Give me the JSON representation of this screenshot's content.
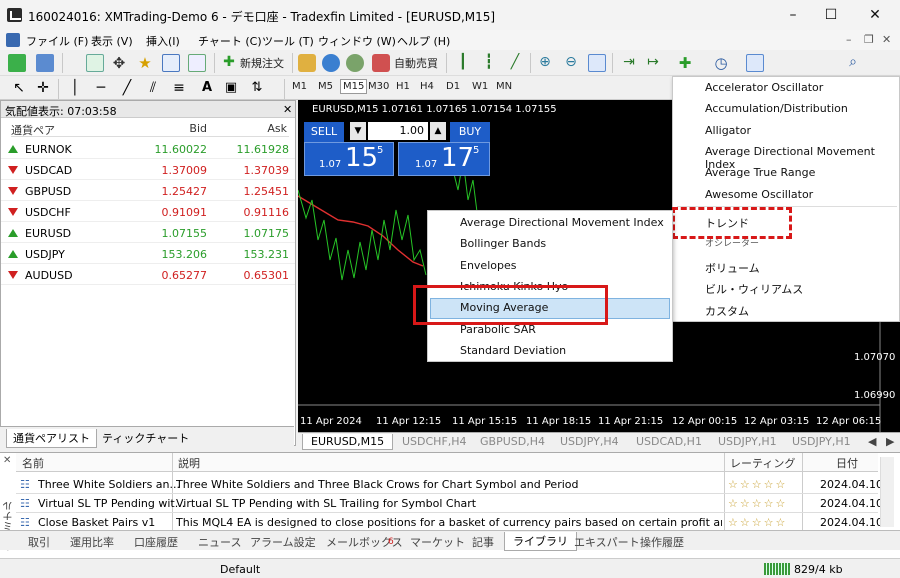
{
  "window": {
    "title": "160024016: XMTrading-Demo 6 - デモ口座 - Tradexfin Limited - [EURUSD,M15]"
  },
  "menu": [
    "ファイル (F)",
    "表示 (V)",
    "挿入(I)",
    "チャート (C)",
    "ツール (T)",
    "ウィンドウ (W)",
    "ヘルプ (H)"
  ],
  "toolbar": {
    "new_order": "新規注文",
    "auto_trade": "自動売買"
  },
  "timeframes": [
    "M1",
    "M5",
    "M15",
    "M30",
    "H1",
    "H4",
    "D1",
    "W1",
    "MN"
  ],
  "market_watch": {
    "header": "気配値表示: 07:03:58",
    "col_pair": "通貨ペア",
    "col_bid": "Bid",
    "col_ask": "Ask",
    "rows": [
      {
        "pair": "EURNOK",
        "bid": "11.60022",
        "ask": "11.61928",
        "dir": "up"
      },
      {
        "pair": "USDCAD",
        "bid": "1.37009",
        "ask": "1.37039",
        "dir": "down"
      },
      {
        "pair": "GBPUSD",
        "bid": "1.25427",
        "ask": "1.25451",
        "dir": "down"
      },
      {
        "pair": "USDCHF",
        "bid": "0.91091",
        "ask": "0.91116",
        "dir": "down"
      },
      {
        "pair": "EURUSD",
        "bid": "1.07155",
        "ask": "1.07175",
        "dir": "up"
      },
      {
        "pair": "USDJPY",
        "bid": "153.206",
        "ask": "153.231",
        "dir": "up"
      },
      {
        "pair": "AUDUSD",
        "bid": "0.65277",
        "ask": "0.65301",
        "dir": "down"
      }
    ],
    "tabs": [
      "通貨ペアリスト",
      "ティックチャート"
    ]
  },
  "chart": {
    "info": "EURUSD,M15   1.07161 1.07165 1.07154 1.07155",
    "sell": "SELL",
    "buy": "BUY",
    "lot": "1.00",
    "sell_prefix": "1.07",
    "sell_big": "15",
    "sell_sup": "5",
    "buy_prefix": "1.07",
    "buy_big": "17",
    "buy_sup": "5",
    "price1": "1.07070",
    "price2": "1.06990",
    "times": [
      "11 Apr 2024",
      "11 Apr 12:15",
      "11 Apr 15:15",
      "11 Apr 18:15",
      "11 Apr 21:15",
      "12 Apr 00:15",
      "12 Apr 03:15",
      "12 Apr 06:15"
    ],
    "tabs": [
      "EURUSD,M15",
      "USDCHF,H4",
      "GBPUSD,H4",
      "USDJPY,H4",
      "USDCAD,H1",
      "USDJPY,H1",
      "USDJPY,H1"
    ]
  },
  "indicator_menu": [
    "Accelerator Oscillator",
    "Accumulation/Distribution",
    "Alligator",
    "Average Directional Movement Index",
    "Average True Range",
    "Awesome Oscillator",
    "トレンド",
    "オシレーター",
    "ボリューム",
    "ビル・ウィリアムス",
    "カスタム"
  ],
  "trend_menu": [
    "Average Directional Movement Index",
    "Bollinger Bands",
    "Envelopes",
    "Ichimoku Kinko Hyo",
    "Moving Average",
    "Parabolic SAR",
    "Standard Deviation"
  ],
  "terminal": {
    "side_label": "ターミナル",
    "col_name": "名前",
    "col_desc": "説明",
    "col_rating": "レーティング",
    "col_date": "日付",
    "rows": [
      {
        "name": "Three White Soldiers an...",
        "desc": "Three White Soldiers and Three Black Crows for Chart Symbol and Period",
        "stars": "☆☆☆☆☆",
        "date": "2024.04.10"
      },
      {
        "name": "Virtual SL TP Pending wit...",
        "desc": "Virtual SL TP Pending with SL Trailing for Symbol Chart",
        "stars": "☆☆☆☆☆",
        "date": "2024.04.10"
      },
      {
        "name": "Close Basket Pairs v1",
        "desc": "This MQL4 EA is designed to close positions for a basket of currency pairs based on certain profit and loss ...",
        "stars": "☆☆☆☆☆",
        "date": "2024.04.10"
      }
    ],
    "tabs": [
      "取引",
      "運用比率",
      "口座履歴",
      "ニュース",
      "アラーム設定",
      "メールボックス",
      "マーケット",
      "記事",
      "ライブラリ",
      "エキスパート",
      "操作履歴"
    ],
    "mailbox_count": "6"
  },
  "status": {
    "profile": "Default",
    "traffic": "829/4 kb"
  },
  "notification_count": "1",
  "colors": {
    "up": "#2a9d2a",
    "down": "#d02020",
    "accent": "#1e5dc8",
    "highlight": "#d81818"
  }
}
